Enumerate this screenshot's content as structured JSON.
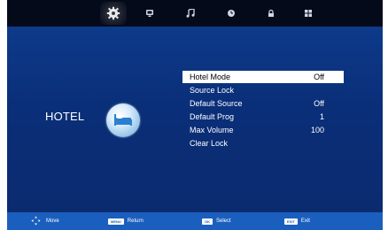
{
  "tabs": [
    {
      "icon": "gear-icon",
      "active": true
    },
    {
      "icon": "tv-icon",
      "active": false
    },
    {
      "icon": "music-icon",
      "active": false
    },
    {
      "icon": "clock-icon",
      "active": false
    },
    {
      "icon": "lock-icon",
      "active": false
    },
    {
      "icon": "grid-icon",
      "active": false
    }
  ],
  "page": {
    "title": "HOTEL",
    "icon": "hotel-bed-icon"
  },
  "menu": {
    "items": [
      {
        "label": "Hotel Mode",
        "value": "Off",
        "selected": true
      },
      {
        "label": "Source Lock",
        "value": ""
      },
      {
        "label": "Default Source",
        "value": "Off"
      },
      {
        "label": "Default Prog",
        "value": "1"
      },
      {
        "label": "Max Volume",
        "value": "100"
      },
      {
        "label": "Clear Lock",
        "value": ""
      }
    ]
  },
  "footer": {
    "move_label": "Move",
    "return_key": "MENU",
    "return_label": "Return",
    "select_key": "OK",
    "select_label": "Select",
    "exit_key": "EXIT",
    "exit_label": "Exit"
  },
  "colors": {
    "background": "#0b2a6e",
    "topbar": "#050a1a",
    "bottombar": "#1b5fbe",
    "highlight": "#ffffff"
  }
}
